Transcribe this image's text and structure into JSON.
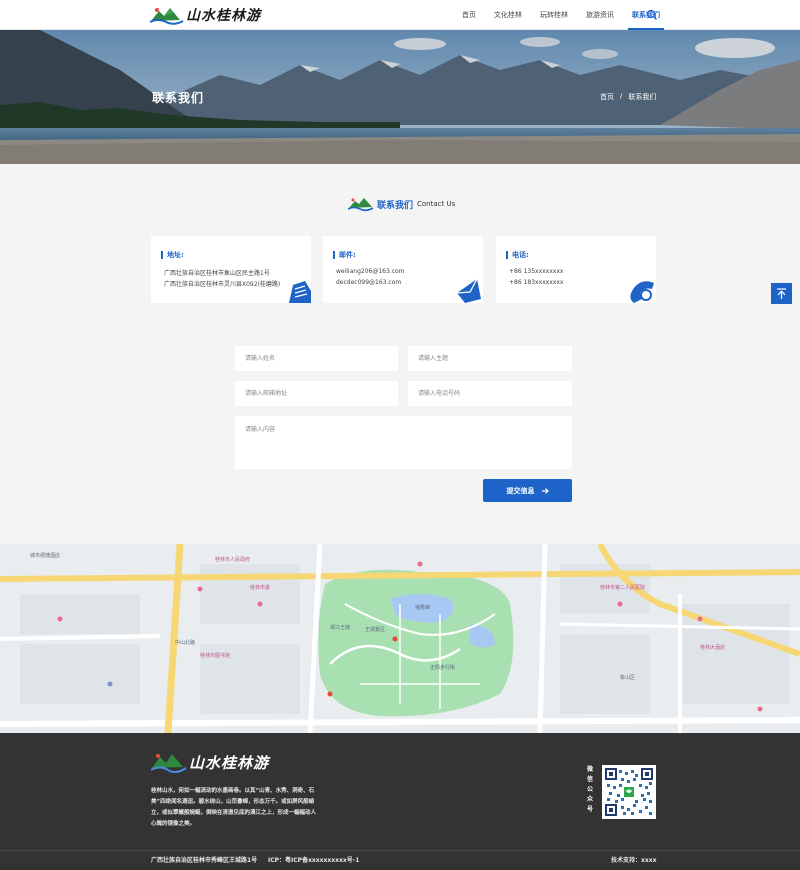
{
  "header": {
    "logo_text": "山水桂林游",
    "nav": [
      {
        "label": "首页"
      },
      {
        "label": "文化桂林"
      },
      {
        "label": "玩转桂林"
      },
      {
        "label": "旅游资讯"
      },
      {
        "label": "联系我们"
      }
    ],
    "active_nav": "联系我们"
  },
  "banner": {
    "title": "联系我们",
    "breadcrumb_home": "首页",
    "breadcrumb_sep": "/",
    "breadcrumb_current": "联系我们"
  },
  "section": {
    "title_cn": "联系我们",
    "title_en": "Contact Us"
  },
  "contact_cards": [
    {
      "label": "地址:",
      "lines": [
        "广西壮族自治区桂林市象山区民主路1号",
        "广西壮族自治区桂林市灵川县X092(桂磨路)"
      ],
      "icon": "building-icon"
    },
    {
      "label": "邮件:",
      "lines": [
        "weiliang206@163.com",
        "decdec099@163.com"
      ],
      "icon": "mail-icon"
    },
    {
      "label": "电话:",
      "lines": [
        "+86 135xxxxxxxx",
        "+86 183xxxxxxxx"
      ],
      "icon": "phone-icon"
    }
  ],
  "form": {
    "name_placeholder": "请输入姓名",
    "subject_placeholder": "请输入主题",
    "email_placeholder": "请输入邮箱地址",
    "phone_placeholder": "请输入电话号码",
    "content_placeholder": "请输入内容",
    "submit_label": "提交信息"
  },
  "map": {
    "labels": [
      "城市便捷酒店",
      "桂林市人民政府",
      "桂林市委",
      "王城景区",
      "正阳步行街",
      "中山北路",
      "桂林市图书馆",
      "靖江王城",
      "桂林市第二人民医院",
      "象山区",
      "桂林大酒店",
      "独秀峰"
    ]
  },
  "footer": {
    "logo_text": "山水桂林游",
    "description": "桂林山水，宛如一幅流动的水墨画卷。以其“山青、水秀、洞奇、石美”四绝闻名遐迩。碧水绕山，山峦叠嶂，形态万千。或如屏风般峭立，或似翠螺般婉蜒，倒映在清澈见底的漓江之上，形成一幅幅动人心魄的镜像之美。",
    "wechat_label": "微信公众号",
    "address": "广西壮族自治区桂林市秀峰区王城路1号",
    "icp": "ICP：粤ICP备xxxxxxxxxx号-1",
    "tech_support": "技术支持：xxxx"
  },
  "colors": {
    "brand_blue": "#1e64c8",
    "footer_bg": "#333333",
    "page_bg": "#f4f4f4"
  }
}
